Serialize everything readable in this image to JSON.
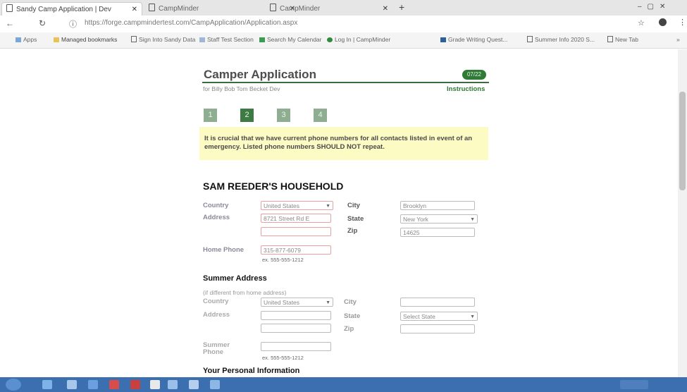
{
  "browser": {
    "tabs": [
      {
        "label": "Sandy Camp Application | Dev",
        "active": true
      },
      {
        "label": "CampMinder",
        "active": false
      },
      {
        "label": "CampMinder",
        "active": false
      }
    ],
    "url": "https://forge.campmindertest.com/CampApplication/Application.aspx",
    "bookmarks": [
      "Apps",
      "Managed bookmarks",
      "Sign Into Sandy Data",
      "Staff Test Section",
      "Search My Calendar",
      "Log In | CampMinder",
      "Grade Writing Quest...",
      "Summer Info 2020 S...",
      "New Tab"
    ]
  },
  "page": {
    "title": "Camper Application",
    "badge": "07/22",
    "subtitle": "for Billy Bob Tom Becket Dev",
    "instructions_link": "Instructions",
    "steps": [
      "1",
      "2",
      "3",
      "4"
    ],
    "notice": "It is crucial that we have current phone numbers for all contacts listed in event of an emergency. Listed phone numbers SHOULD NOT repeat.",
    "household_heading": "SAM REEDER'S HOUSEHOLD",
    "home": {
      "country_label": "Country",
      "country_value": "United States",
      "city_label": "City",
      "city_value": "Brooklyn",
      "address_label": "Address",
      "address_value": "8721 Street Rd E",
      "state_label": "State",
      "state_value": "New York",
      "zip_label": "Zip",
      "zip_value": "14625",
      "home_phone_label": "Home Phone",
      "home_phone_value": "315-877-6079",
      "home_phone_hint": "ex. 555-555-1212"
    },
    "summer_heading": "Summer Address",
    "summer": {
      "note": "(if different from home address)",
      "country_label": "Country",
      "country_value": "United States",
      "city_label": "City",
      "address_label": "Address",
      "state_label": "State",
      "state_placeholder": "Select State",
      "zip_label": "Zip",
      "phone_label": "Summer Phone",
      "phone_hint": "ex. 555-555-1212"
    },
    "personal_heading": "Your Personal Information"
  }
}
